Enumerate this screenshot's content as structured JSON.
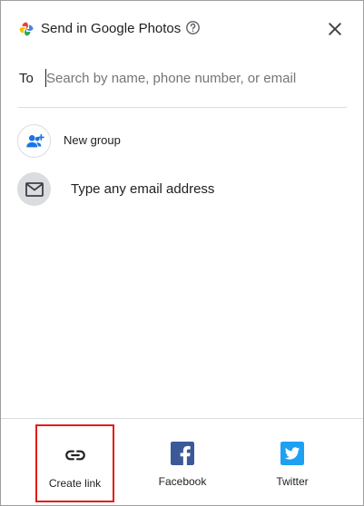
{
  "header": {
    "title": "Send in Google Photos",
    "logo_icon": "google-photos-pinwheel-icon",
    "help_icon": "help-circle-icon",
    "close_icon": "close-icon"
  },
  "recipient": {
    "label": "To",
    "placeholder": "Search by name, phone number, or email"
  },
  "options": [
    {
      "icon": "add-group-icon",
      "label": "New group"
    },
    {
      "icon": "mail-icon",
      "label": "Type any email address"
    }
  ],
  "share": [
    {
      "icon": "link-icon",
      "label": "Create link"
    },
    {
      "icon": "facebook-icon",
      "label": "Facebook"
    },
    {
      "icon": "twitter-icon",
      "label": "Twitter"
    }
  ],
  "colors": {
    "facebook": "#3b5998",
    "twitter": "#1da1f2",
    "group_icon": "#1a73e8",
    "highlight": "#e41b17"
  }
}
